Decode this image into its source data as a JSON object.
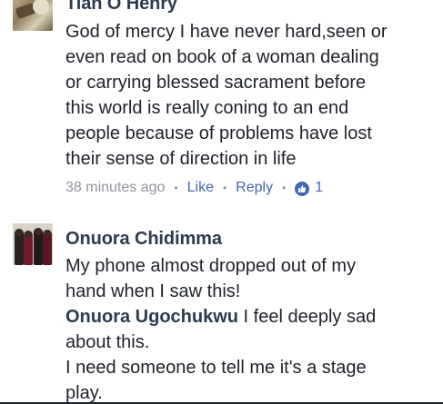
{
  "comments": [
    {
      "author": "Tian O Henry",
      "lines": [
        "God of mercy I have never hard,seen or",
        "even read on book of a woman dealing",
        "or carrying blessed sacrament before",
        "this world is really coning to an end",
        "people because of problems have lost",
        "their sense of direction in life"
      ],
      "meta": {
        "time": "38 minutes ago",
        "separator": "•",
        "like_label": "Like",
        "reply_label": "Reply",
        "reaction_icon": "thumbs-up-icon",
        "reaction_count": "1"
      }
    },
    {
      "author": "Onuora Chidimma",
      "lines": [
        "My phone almost dropped out of my",
        "hand when I saw this!"
      ],
      "mention": "Onuora Ugochukwu",
      "mention_text_1": " I feel deeply sad",
      "lines_after_mention": [
        "about this.",
        "I need someone to tell me it's a stage",
        "play."
      ]
    }
  ],
  "colors": {
    "author": "#2c3a50",
    "text": "#1d2129",
    "meta": "#90949c",
    "link": "#4267b2"
  }
}
